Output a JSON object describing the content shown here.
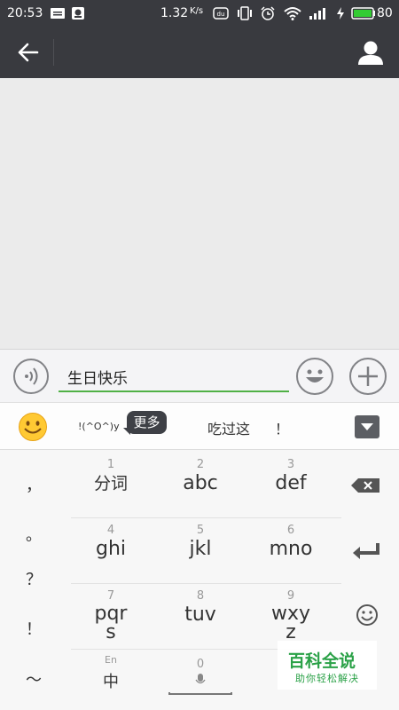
{
  "status_bar": {
    "time": "20:53",
    "speed": "1.32",
    "speed_unit": "K/s",
    "battery": "80",
    "icons": [
      "message-icon",
      "notification-icon",
      "hd-icon",
      "vibrate-icon",
      "alarm-icon",
      "wifi-icon",
      "signal-icon",
      "charging-icon",
      "battery-icon"
    ]
  },
  "title_bar": {
    "back_icon": "back-arrow-icon",
    "profile_icon": "person-icon"
  },
  "input_bar": {
    "text_value": "生日快乐",
    "voice_icon": "voice-icon",
    "emoji_icon": "emoji-icon",
    "plus_icon": "plus-icon",
    "accent_color": "#4fb045"
  },
  "candidates": {
    "kaomoji": "!(^O^)y",
    "more_label": "更多",
    "items": [
      "吃过这",
      "！"
    ],
    "emoji_icon": "smiley-icon",
    "collapse_icon": "collapse-icon"
  },
  "keyboard": {
    "punctuation": [
      "，",
      "。",
      "？",
      "！",
      "～"
    ],
    "keys": [
      {
        "num": "1",
        "label": "分词"
      },
      {
        "num": "2",
        "label": "abc"
      },
      {
        "num": "3",
        "label": "def"
      },
      {
        "num": "4",
        "label": "ghi"
      },
      {
        "num": "5",
        "label": "jkl"
      },
      {
        "num": "6",
        "label": "mno"
      },
      {
        "num": "7",
        "label": "pqrs"
      },
      {
        "num": "8",
        "label": "tuv"
      },
      {
        "num": "9",
        "label": "wxyz"
      }
    ],
    "lang_hint": "En",
    "lang_label": "中",
    "space_num": "0",
    "right_icons": [
      "backspace-icon",
      "enter-icon",
      "emoticon-icon"
    ]
  },
  "watermark": {
    "title": "百科全说",
    "subtitle": "助你轻松解决"
  }
}
